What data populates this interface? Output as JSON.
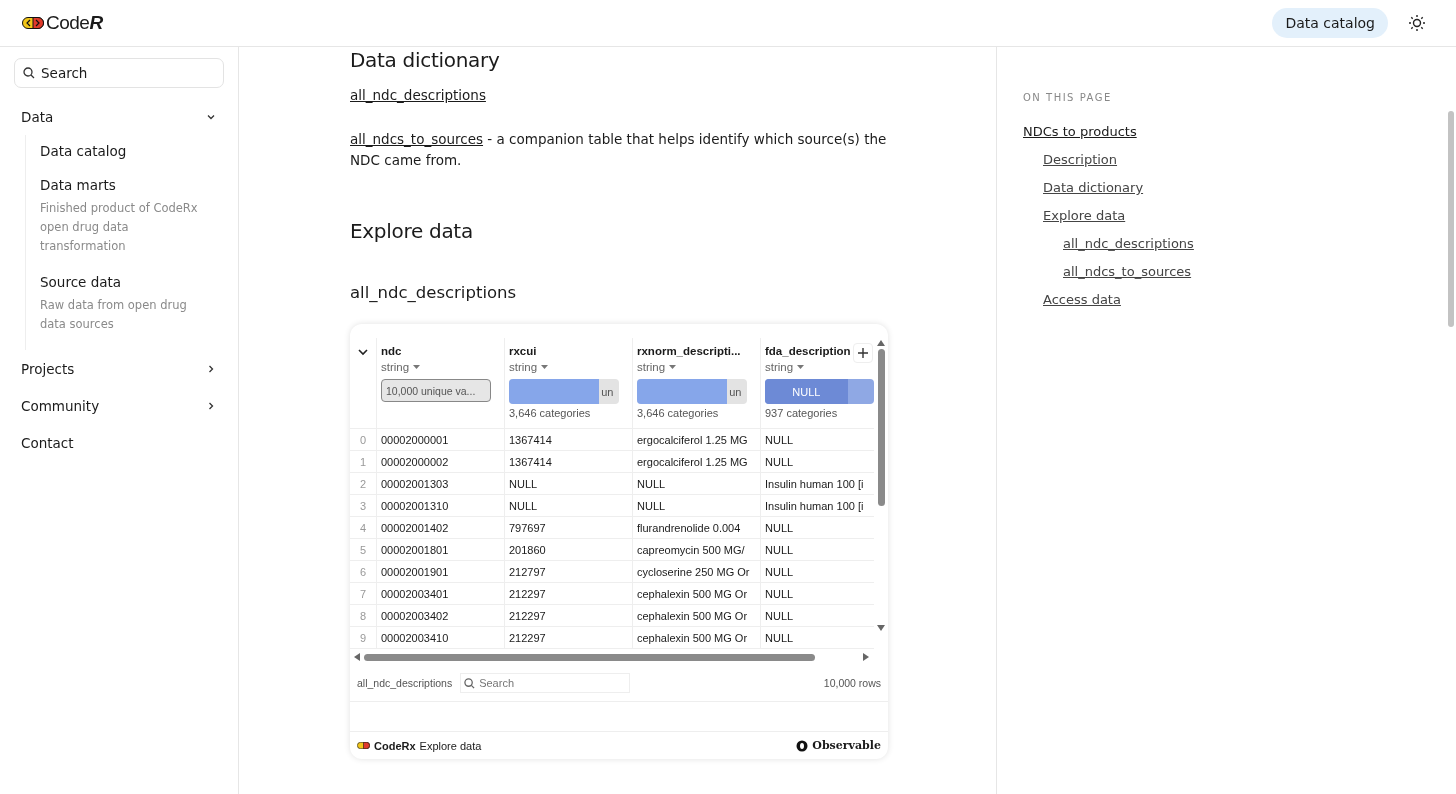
{
  "header": {
    "logo_text": "Code",
    "logo_mark": "R",
    "nav_button": "Data catalog"
  },
  "sidebar": {
    "search": {
      "placeholder": "Search"
    },
    "items": [
      {
        "label": "Data",
        "kind": "group",
        "expanded": true,
        "children": [
          {
            "label": "Data catalog"
          },
          {
            "label": "Data marts",
            "description": "Finished product of CodeRx open drug data transformation"
          },
          {
            "label": "Source data",
            "description": "Raw data from open drug data sources"
          }
        ]
      },
      {
        "label": "Projects",
        "kind": "group",
        "expanded": false
      },
      {
        "label": "Community",
        "kind": "group",
        "expanded": false
      },
      {
        "label": "Contact",
        "kind": "link"
      }
    ]
  },
  "content": {
    "heading": "Data dictionary",
    "links": [
      {
        "link": "all_ndc_descriptions"
      },
      {
        "link": "all_ndcs_to_sources",
        "text": " - a companion table that helps identify which source(s) the NDC came from."
      }
    ],
    "explore_heading": "Explore data",
    "table_heading": "all_ndc_descriptions",
    "table": {
      "columns": [
        {
          "name": "ndc",
          "type": "string",
          "summary": {
            "kind": "unique",
            "label": "10,000 unique va..."
          }
        },
        {
          "name": "rxcui",
          "type": "string",
          "summary": {
            "kind": "bar",
            "label": "un",
            "level": 0.82,
            "caption": "3,646 categories"
          }
        },
        {
          "name": "rxnorm_descripti...",
          "type": "string",
          "summary": {
            "kind": "bar",
            "label": "un",
            "level": 0.82,
            "caption": "3,646 categories"
          }
        },
        {
          "name": "fda_description",
          "type": "string",
          "summary": {
            "kind": "null",
            "label": "NULL",
            "level": 0.76,
            "caption": "937 categories"
          }
        }
      ],
      "rows": [
        {
          "index": "0",
          "cells": [
            "00002000001",
            "1367414",
            "ergocalciferol 1.25 MG",
            "NULL"
          ]
        },
        {
          "index": "1",
          "cells": [
            "00002000002",
            "1367414",
            "ergocalciferol 1.25 MG",
            "NULL"
          ]
        },
        {
          "index": "2",
          "cells": [
            "00002001303",
            "NULL",
            "NULL",
            "Insulin human 100 [i"
          ]
        },
        {
          "index": "3",
          "cells": [
            "00002001310",
            "NULL",
            "NULL",
            "Insulin human 100 [i"
          ]
        },
        {
          "index": "4",
          "cells": [
            "00002001402",
            "797697",
            "flurandrenolide 0.004",
            "NULL"
          ]
        },
        {
          "index": "5",
          "cells": [
            "00002001801",
            "201860",
            "capreomycin 500 MG/",
            "NULL"
          ]
        },
        {
          "index": "6",
          "cells": [
            "00002001901",
            "212797",
            "cycloserine 250 MG Or",
            "NULL"
          ]
        },
        {
          "index": "7",
          "cells": [
            "00002003401",
            "212297",
            "cephalexin 500 MG Or",
            "NULL"
          ]
        },
        {
          "index": "8",
          "cells": [
            "00002003402",
            "212297",
            "cephalexin 500 MG Or",
            "NULL"
          ]
        },
        {
          "index": "9",
          "cells": [
            "00002003410",
            "212297",
            "cephalexin 500 MG Or",
            "NULL"
          ]
        }
      ],
      "footer_name": "all_ndc_descriptions",
      "search": {
        "placeholder": "Search"
      },
      "row_count": "10,000 rows"
    },
    "embed_footer": {
      "brand": "CodeRx",
      "title": "Explore data",
      "credit": "Observable"
    }
  },
  "toc": {
    "title": "ON THIS PAGE",
    "items": [
      {
        "label": "NDCs to products",
        "children": [
          {
            "label": "Description"
          },
          {
            "label": "Data dictionary"
          },
          {
            "label": "Explore data",
            "children": [
              {
                "label": "all_ndc_descriptions"
              },
              {
                "label": "all_ndcs_to_sources"
              }
            ]
          },
          {
            "label": "Access data"
          }
        ]
      }
    ]
  }
}
